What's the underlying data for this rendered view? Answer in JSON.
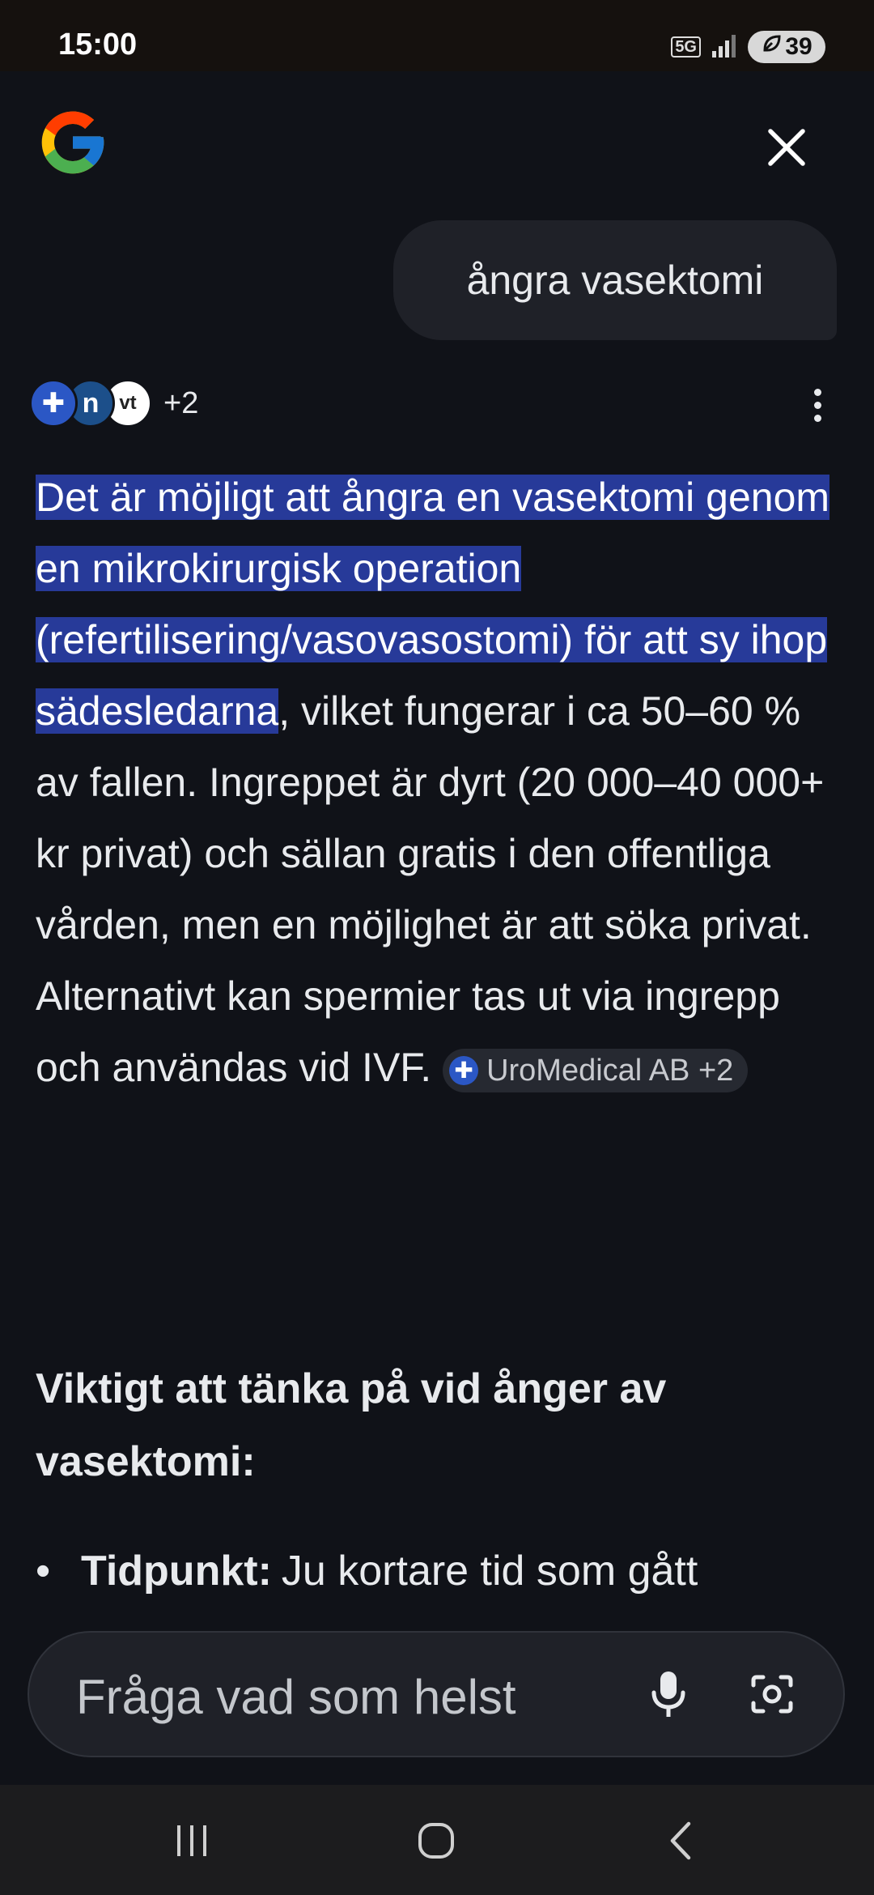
{
  "status_bar": {
    "time": "15:00",
    "network": "5G",
    "battery": "39",
    "icons": [
      "5g-icon",
      "signal-icon",
      "battery-saver-icon"
    ]
  },
  "header": {
    "logo": "google-g-logo",
    "close_icon": "close-icon"
  },
  "query": {
    "text": "ångra vasektomi"
  },
  "sources": {
    "favicons": [
      "uromedical-icon",
      "source-n-icon",
      "vt-icon"
    ],
    "more_count": "+2"
  },
  "answer": {
    "highlighted": " Det är möjligt att ångra en vasektomi genom en mikrokirurgisk operation (refertilisering/vasovasostomi) för att sy ihop sädesledarna",
    "rest": ", vilket fungerar i ca 50–60 % av fallen. Ingreppet är dyrt (20 000–40 000+ kr privat) och sällan gratis i den offentliga vården, men en möjlighet är att söka privat. Alternativt kan spermier tas ut via ingrepp och användas vid IVF. ",
    "citation_chip": "UroMedical AB +2"
  },
  "section": {
    "heading": "Viktigt att tänka på vid ånger av vasektomi:",
    "bullets": [
      {
        "bold": "Tidpunkt:",
        "text": "Ju kortare tid som gått"
      }
    ]
  },
  "ask_bar": {
    "placeholder": "Fråga vad som helst"
  },
  "nav_bar": {
    "icons": [
      "recent-apps-icon",
      "home-icon",
      "back-icon"
    ]
  },
  "colors": {
    "background": "#101218",
    "highlight": "#273a99",
    "bubble": "#1f2128"
  }
}
